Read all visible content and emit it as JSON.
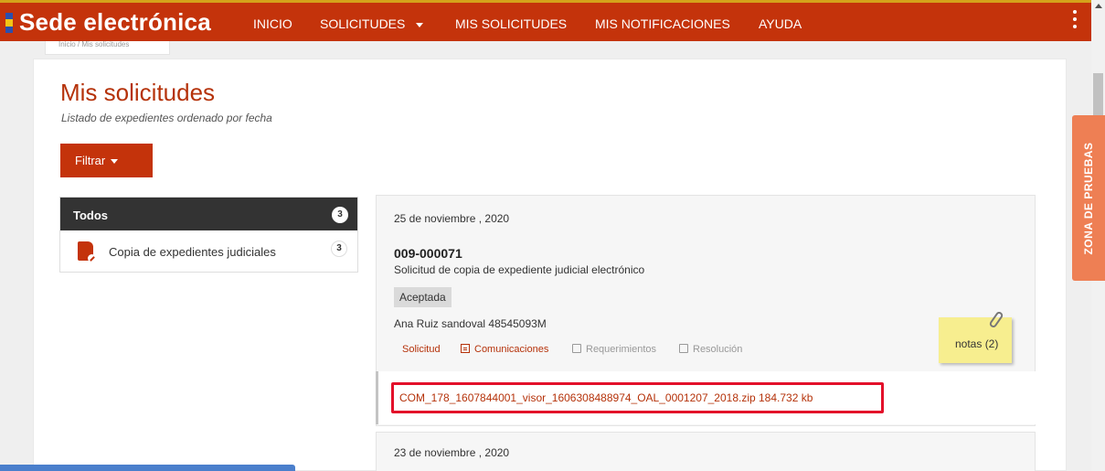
{
  "header": {
    "brand": "Sede electrónica",
    "nav": [
      "INICIO",
      "SOLICITUDES",
      "MIS SOLICITUDES",
      "MIS NOTIFICACIONES",
      "AYUDA"
    ],
    "flag_colors": [
      "#2b4fae",
      "#f3c516",
      "#2b4fae"
    ],
    "accent": "#c4330b"
  },
  "breadcrumb": "Inicio / Mis solicitudes",
  "page": {
    "title": "Mis solicitudes",
    "subtitle": "Listado de expedientes ordenado por fecha",
    "filter_label": "Filtrar"
  },
  "sidebar": {
    "header_label": "Todos",
    "header_count": "3",
    "items": [
      {
        "label": "Copia de expedientes judiciales",
        "count": "3",
        "icon": "document-edit-icon"
      }
    ]
  },
  "requests": [
    {
      "date": "25 de noviembre , 2020",
      "id": "009-000071",
      "description": "Solicitud de copia de expediente judicial electrónico",
      "status": "Aceptada",
      "person": "Ana Ruiz sandoval 48545093M",
      "tabs": [
        "Solicitud",
        "Comunicaciones",
        "Requerimientos",
        "Resolución"
      ],
      "notes": "notas (2)",
      "attachment": "COM_178_1607844001_visor_1606308488974_OAL_0001207_2018.zip 184.732 kb"
    },
    {
      "date": "23 de noviembre , 2020"
    }
  ],
  "side_tab": "ZONA DE PRUEBAS"
}
